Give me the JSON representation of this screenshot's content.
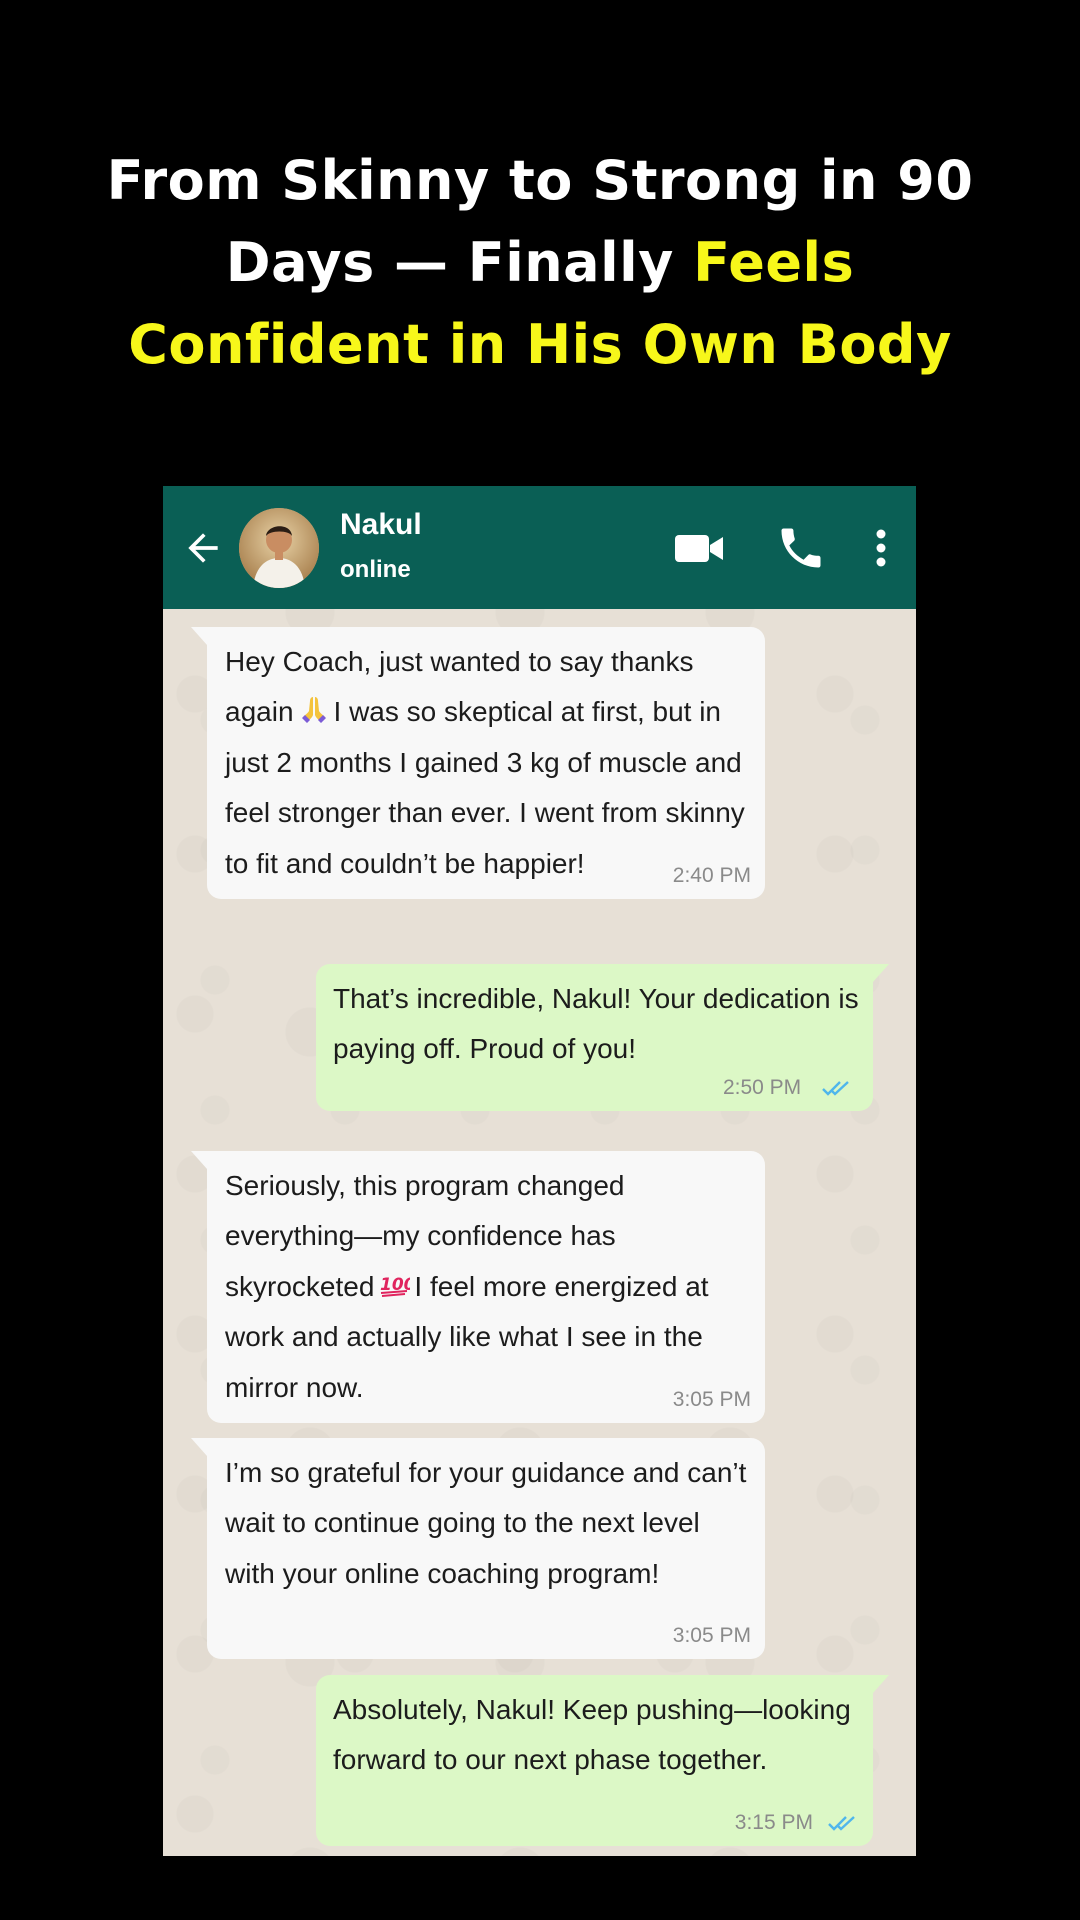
{
  "headline": {
    "line1": "From Skinny to Strong in 90",
    "line2_white": "Days — Finally ",
    "line2_yellow": "Feels",
    "line3_yellow": "Confident in His Own Body",
    "colors": {
      "white": "#ffffff",
      "yellow": "#f7f71a"
    }
  },
  "chat_header": {
    "contact_name": "Nakul",
    "status": "online",
    "back_icon": "arrow-left-icon",
    "video_icon": "video-camera-icon",
    "call_icon": "phone-icon",
    "menu_icon": "more-vertical-icon",
    "color": "#0a5f55"
  },
  "messages": [
    {
      "direction": "incoming",
      "text_before_emoji": "Hey Coach, just wanted to say thanks again",
      "emoji": "folded-hands-emoji",
      "text_after_emoji": "I was so skeptical at first, but in just 2 months I gained 3 kg of muscle and feel stronger than ever. I went from skinny to fit and couldn’t be happier!",
      "time": "2:40 PM"
    },
    {
      "direction": "outgoing",
      "text": "That’s incredible, Nakul! Your dedication is paying off. Proud of you!",
      "time": "2:50 PM",
      "status_icon": "double-check-icon"
    },
    {
      "direction": "incoming",
      "text_before_emoji": "Seriously, this program changed everything—my confidence has skyrocketed",
      "emoji": "hundred-points-emoji",
      "text_after_emoji": "I feel more energized at work and actually like what I see in the mirror now.",
      "time": "3:05 PM"
    },
    {
      "direction": "incoming",
      "text": "I’m so grateful for your guidance and can’t wait to continue going to the next level with your online coaching program!",
      "time": "3:05 PM"
    },
    {
      "direction": "outgoing",
      "text": "Absolutely, Nakul! Keep pushing—looking forward to our next phase together.",
      "time": "3:15 PM",
      "status_icon": "double-check-icon"
    }
  ],
  "colors": {
    "incoming_bubble": "#f8f8f8",
    "outgoing_bubble": "#dcf8c6",
    "read_ticks": "#4fb6ec",
    "chat_background": "#e7e0d6"
  }
}
